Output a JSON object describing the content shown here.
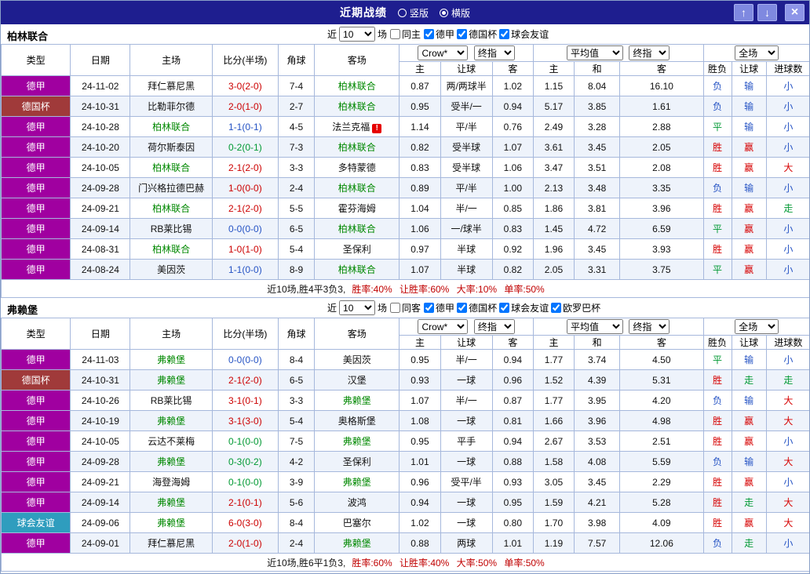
{
  "titlebar": {
    "title": "近期战绩",
    "vertical_label": "竖版",
    "horizontal_label": "横版",
    "selected_layout": "横版",
    "up_glyph": "↑",
    "down_glyph": "↓",
    "close_glyph": "×"
  },
  "filter": {
    "near": "近",
    "matches": "场"
  },
  "selects": {
    "bookmaker": "Crow*",
    "final": "终指",
    "average": "平均值",
    "full_match": "全场"
  },
  "columns": [
    "类型",
    "日期",
    "主场",
    "比分(半场)",
    "角球",
    "客场",
    "主",
    "让球",
    "客",
    "主",
    "和",
    "客",
    "胜负",
    "让球",
    "进球数"
  ],
  "misc": {
    "alert_glyph": "!"
  },
  "colors": {
    "titlebar_bg": "#1e1e8f",
    "bundesliga_badge": "#a000a0",
    "dfb_pokal_badge": "#a03a3a",
    "club_friendly_badge": "#2f9dbe",
    "tracked_team_green": "#008800",
    "win_red": "#d60000",
    "loss_blue": "#2553c4",
    "push_green": "#009933",
    "summary_red": "#c00000",
    "row_stripe": "#eef3fb",
    "table_border": "#a6b8dc"
  },
  "sections": [
    {
      "team": "柏林联合",
      "count": "10",
      "same_venue_label": "同主",
      "league_filters": [
        "德甲",
        "德国杯",
        "球会友谊"
      ],
      "rows": [
        {
          "type": "德甲",
          "date": "24-11-02",
          "home": "拜仁慕尼黑",
          "score": "3-0(2-0)",
          "sr": "hw",
          "corners": "7-4",
          "away": "柏林联合",
          "side": "away",
          "ah": [
            "0.87",
            "两/两球半",
            "1.02"
          ],
          "eu": [
            "1.15",
            "8.04",
            "16.10"
          ],
          "res": [
            "负",
            "输",
            "小"
          ]
        },
        {
          "type": "德国杯",
          "date": "24-10-31",
          "home": "比勒菲尔德",
          "score": "2-0(1-0)",
          "sr": "hw",
          "corners": "2-7",
          "away": "柏林联合",
          "side": "away",
          "ah": [
            "0.95",
            "受半/一",
            "0.94"
          ],
          "eu": [
            "5.17",
            "3.85",
            "1.61"
          ],
          "res": [
            "负",
            "输",
            "小"
          ]
        },
        {
          "type": "德甲",
          "date": "24-10-28",
          "home": "柏林联合",
          "score": "1-1(0-1)",
          "sr": "d",
          "corners": "4-5",
          "away": "法兰克福",
          "side": "home",
          "alert": "away",
          "ah": [
            "1.14",
            "平/半",
            "0.76"
          ],
          "eu": [
            "2.49",
            "3.28",
            "2.88"
          ],
          "res": [
            "平",
            "输",
            "小"
          ]
        },
        {
          "type": "德甲",
          "date": "24-10-20",
          "home": "荷尔斯泰因",
          "score": "0-2(0-1)",
          "sr": "hl",
          "corners": "7-3",
          "away": "柏林联合",
          "side": "away",
          "ah": [
            "0.82",
            "受半球",
            "1.07"
          ],
          "eu": [
            "3.61",
            "3.45",
            "2.05"
          ],
          "res": [
            "胜",
            "赢",
            "小"
          ]
        },
        {
          "type": "德甲",
          "date": "24-10-05",
          "home": "柏林联合",
          "score": "2-1(2-0)",
          "sr": "hw",
          "corners": "3-3",
          "away": "多特蒙德",
          "side": "home",
          "ah": [
            "0.83",
            "受半球",
            "1.06"
          ],
          "eu": [
            "3.47",
            "3.51",
            "2.08"
          ],
          "res": [
            "胜",
            "赢",
            "大"
          ]
        },
        {
          "type": "德甲",
          "date": "24-09-28",
          "home": "门兴格拉德巴赫",
          "score": "1-0(0-0)",
          "sr": "hw",
          "corners": "2-4",
          "away": "柏林联合",
          "side": "away",
          "ah": [
            "0.89",
            "平/半",
            "1.00"
          ],
          "eu": [
            "2.13",
            "3.48",
            "3.35"
          ],
          "res": [
            "负",
            "输",
            "小"
          ]
        },
        {
          "type": "德甲",
          "date": "24-09-21",
          "home": "柏林联合",
          "score": "2-1(2-0)",
          "sr": "hw",
          "corners": "5-5",
          "away": "霍芬海姆",
          "side": "home",
          "ah": [
            "1.04",
            "半/一",
            "0.85"
          ],
          "eu": [
            "1.86",
            "3.81",
            "3.96"
          ],
          "res": [
            "胜",
            "赢",
            "走"
          ]
        },
        {
          "type": "德甲",
          "date": "24-09-14",
          "home": "RB莱比锡",
          "score": "0-0(0-0)",
          "sr": "d",
          "corners": "6-5",
          "away": "柏林联合",
          "side": "away",
          "ah": [
            "1.06",
            "一/球半",
            "0.83"
          ],
          "eu": [
            "1.45",
            "4.72",
            "6.59"
          ],
          "res": [
            "平",
            "赢",
            "小"
          ]
        },
        {
          "type": "德甲",
          "date": "24-08-31",
          "home": "柏林联合",
          "score": "1-0(1-0)",
          "sr": "hw",
          "corners": "5-4",
          "away": "圣保利",
          "side": "home",
          "ah": [
            "0.97",
            "半球",
            "0.92"
          ],
          "eu": [
            "1.96",
            "3.45",
            "3.93"
          ],
          "res": [
            "胜",
            "赢",
            "小"
          ]
        },
        {
          "type": "德甲",
          "date": "24-08-24",
          "home": "美因茨",
          "score": "1-1(0-0)",
          "sr": "d",
          "corners": "8-9",
          "away": "柏林联合",
          "side": "away",
          "ah": [
            "1.07",
            "半球",
            "0.82"
          ],
          "eu": [
            "2.05",
            "3.31",
            "3.75"
          ],
          "res": [
            "平",
            "赢",
            "小"
          ]
        }
      ],
      "summary_record": "近10场,胜4平3负3,",
      "summary_rates": "胜率:40% 让胜率:60% 大率:10% 单率:50%"
    },
    {
      "team": "弗赖堡",
      "count": "10",
      "same_venue_label": "同客",
      "league_filters": [
        "德甲",
        "德国杯",
        "球会友谊",
        "欧罗巴杯"
      ],
      "rows": [
        {
          "type": "德甲",
          "date": "24-11-03",
          "home": "弗赖堡",
          "score": "0-0(0-0)",
          "sr": "d",
          "corners": "8-4",
          "away": "美因茨",
          "side": "home",
          "ah": [
            "0.95",
            "半/一",
            "0.94"
          ],
          "eu": [
            "1.77",
            "3.74",
            "4.50"
          ],
          "res": [
            "平",
            "输",
            "小"
          ]
        },
        {
          "type": "德国杯",
          "date": "24-10-31",
          "home": "弗赖堡",
          "score": "2-1(2-0)",
          "sr": "hw",
          "corners": "6-5",
          "away": "汉堡",
          "side": "home",
          "ah": [
            "0.93",
            "一球",
            "0.96"
          ],
          "eu": [
            "1.52",
            "4.39",
            "5.31"
          ],
          "res": [
            "胜",
            "走",
            "走"
          ]
        },
        {
          "type": "德甲",
          "date": "24-10-26",
          "home": "RB莱比锡",
          "score": "3-1(0-1)",
          "sr": "hw",
          "corners": "3-3",
          "away": "弗赖堡",
          "side": "away",
          "ah": [
            "1.07",
            "半/一",
            "0.87"
          ],
          "eu": [
            "1.77",
            "3.95",
            "4.20"
          ],
          "res": [
            "负",
            "输",
            "大"
          ]
        },
        {
          "type": "德甲",
          "date": "24-10-19",
          "home": "弗赖堡",
          "score": "3-1(3-0)",
          "sr": "hw",
          "corners": "5-4",
          "away": "奥格斯堡",
          "side": "home",
          "ah": [
            "1.08",
            "一球",
            "0.81"
          ],
          "eu": [
            "1.66",
            "3.96",
            "4.98"
          ],
          "res": [
            "胜",
            "赢",
            "大"
          ]
        },
        {
          "type": "德甲",
          "date": "24-10-05",
          "home": "云达不莱梅",
          "score": "0-1(0-0)",
          "sr": "hl",
          "corners": "7-5",
          "away": "弗赖堡",
          "side": "away",
          "ah": [
            "0.95",
            "平手",
            "0.94"
          ],
          "eu": [
            "2.67",
            "3.53",
            "2.51"
          ],
          "res": [
            "胜",
            "赢",
            "小"
          ]
        },
        {
          "type": "德甲",
          "date": "24-09-28",
          "home": "弗赖堡",
          "score": "0-3(0-2)",
          "sr": "hl",
          "corners": "4-2",
          "away": "圣保利",
          "side": "home",
          "ah": [
            "1.01",
            "一球",
            "0.88"
          ],
          "eu": [
            "1.58",
            "4.08",
            "5.59"
          ],
          "res": [
            "负",
            "输",
            "大"
          ]
        },
        {
          "type": "德甲",
          "date": "24-09-21",
          "home": "海登海姆",
          "score": "0-1(0-0)",
          "sr": "hl",
          "corners": "3-9",
          "away": "弗赖堡",
          "side": "away",
          "ah": [
            "0.96",
            "受平/半",
            "0.93"
          ],
          "eu": [
            "3.05",
            "3.45",
            "2.29"
          ],
          "res": [
            "胜",
            "赢",
            "小"
          ]
        },
        {
          "type": "德甲",
          "date": "24-09-14",
          "home": "弗赖堡",
          "score": "2-1(0-1)",
          "sr": "hw",
          "corners": "5-6",
          "away": "波鸿",
          "side": "home",
          "ah": [
            "0.94",
            "一球",
            "0.95"
          ],
          "eu": [
            "1.59",
            "4.21",
            "5.28"
          ],
          "res": [
            "胜",
            "走",
            "大"
          ]
        },
        {
          "type": "球会友谊",
          "date": "24-09-06",
          "home": "弗赖堡",
          "score": "6-0(3-0)",
          "sr": "hw",
          "corners": "8-4",
          "away": "巴塞尔",
          "side": "home",
          "ah": [
            "1.02",
            "一球",
            "0.80"
          ],
          "eu": [
            "1.70",
            "3.98",
            "4.09"
          ],
          "res": [
            "胜",
            "赢",
            "大"
          ]
        },
        {
          "type": "德甲",
          "date": "24-09-01",
          "home": "拜仁慕尼黑",
          "score": "2-0(1-0)",
          "sr": "hw",
          "corners": "2-4",
          "away": "弗赖堡",
          "side": "away",
          "ah": [
            "0.88",
            "两球",
            "1.01"
          ],
          "eu": [
            "1.19",
            "7.57",
            "12.06"
          ],
          "res": [
            "负",
            "走",
            "小"
          ]
        }
      ],
      "summary_record": "近10场,胜6平1负3,",
      "summary_rates": "胜率:60% 让胜率:40% 大率:50% 单率:50%"
    }
  ]
}
